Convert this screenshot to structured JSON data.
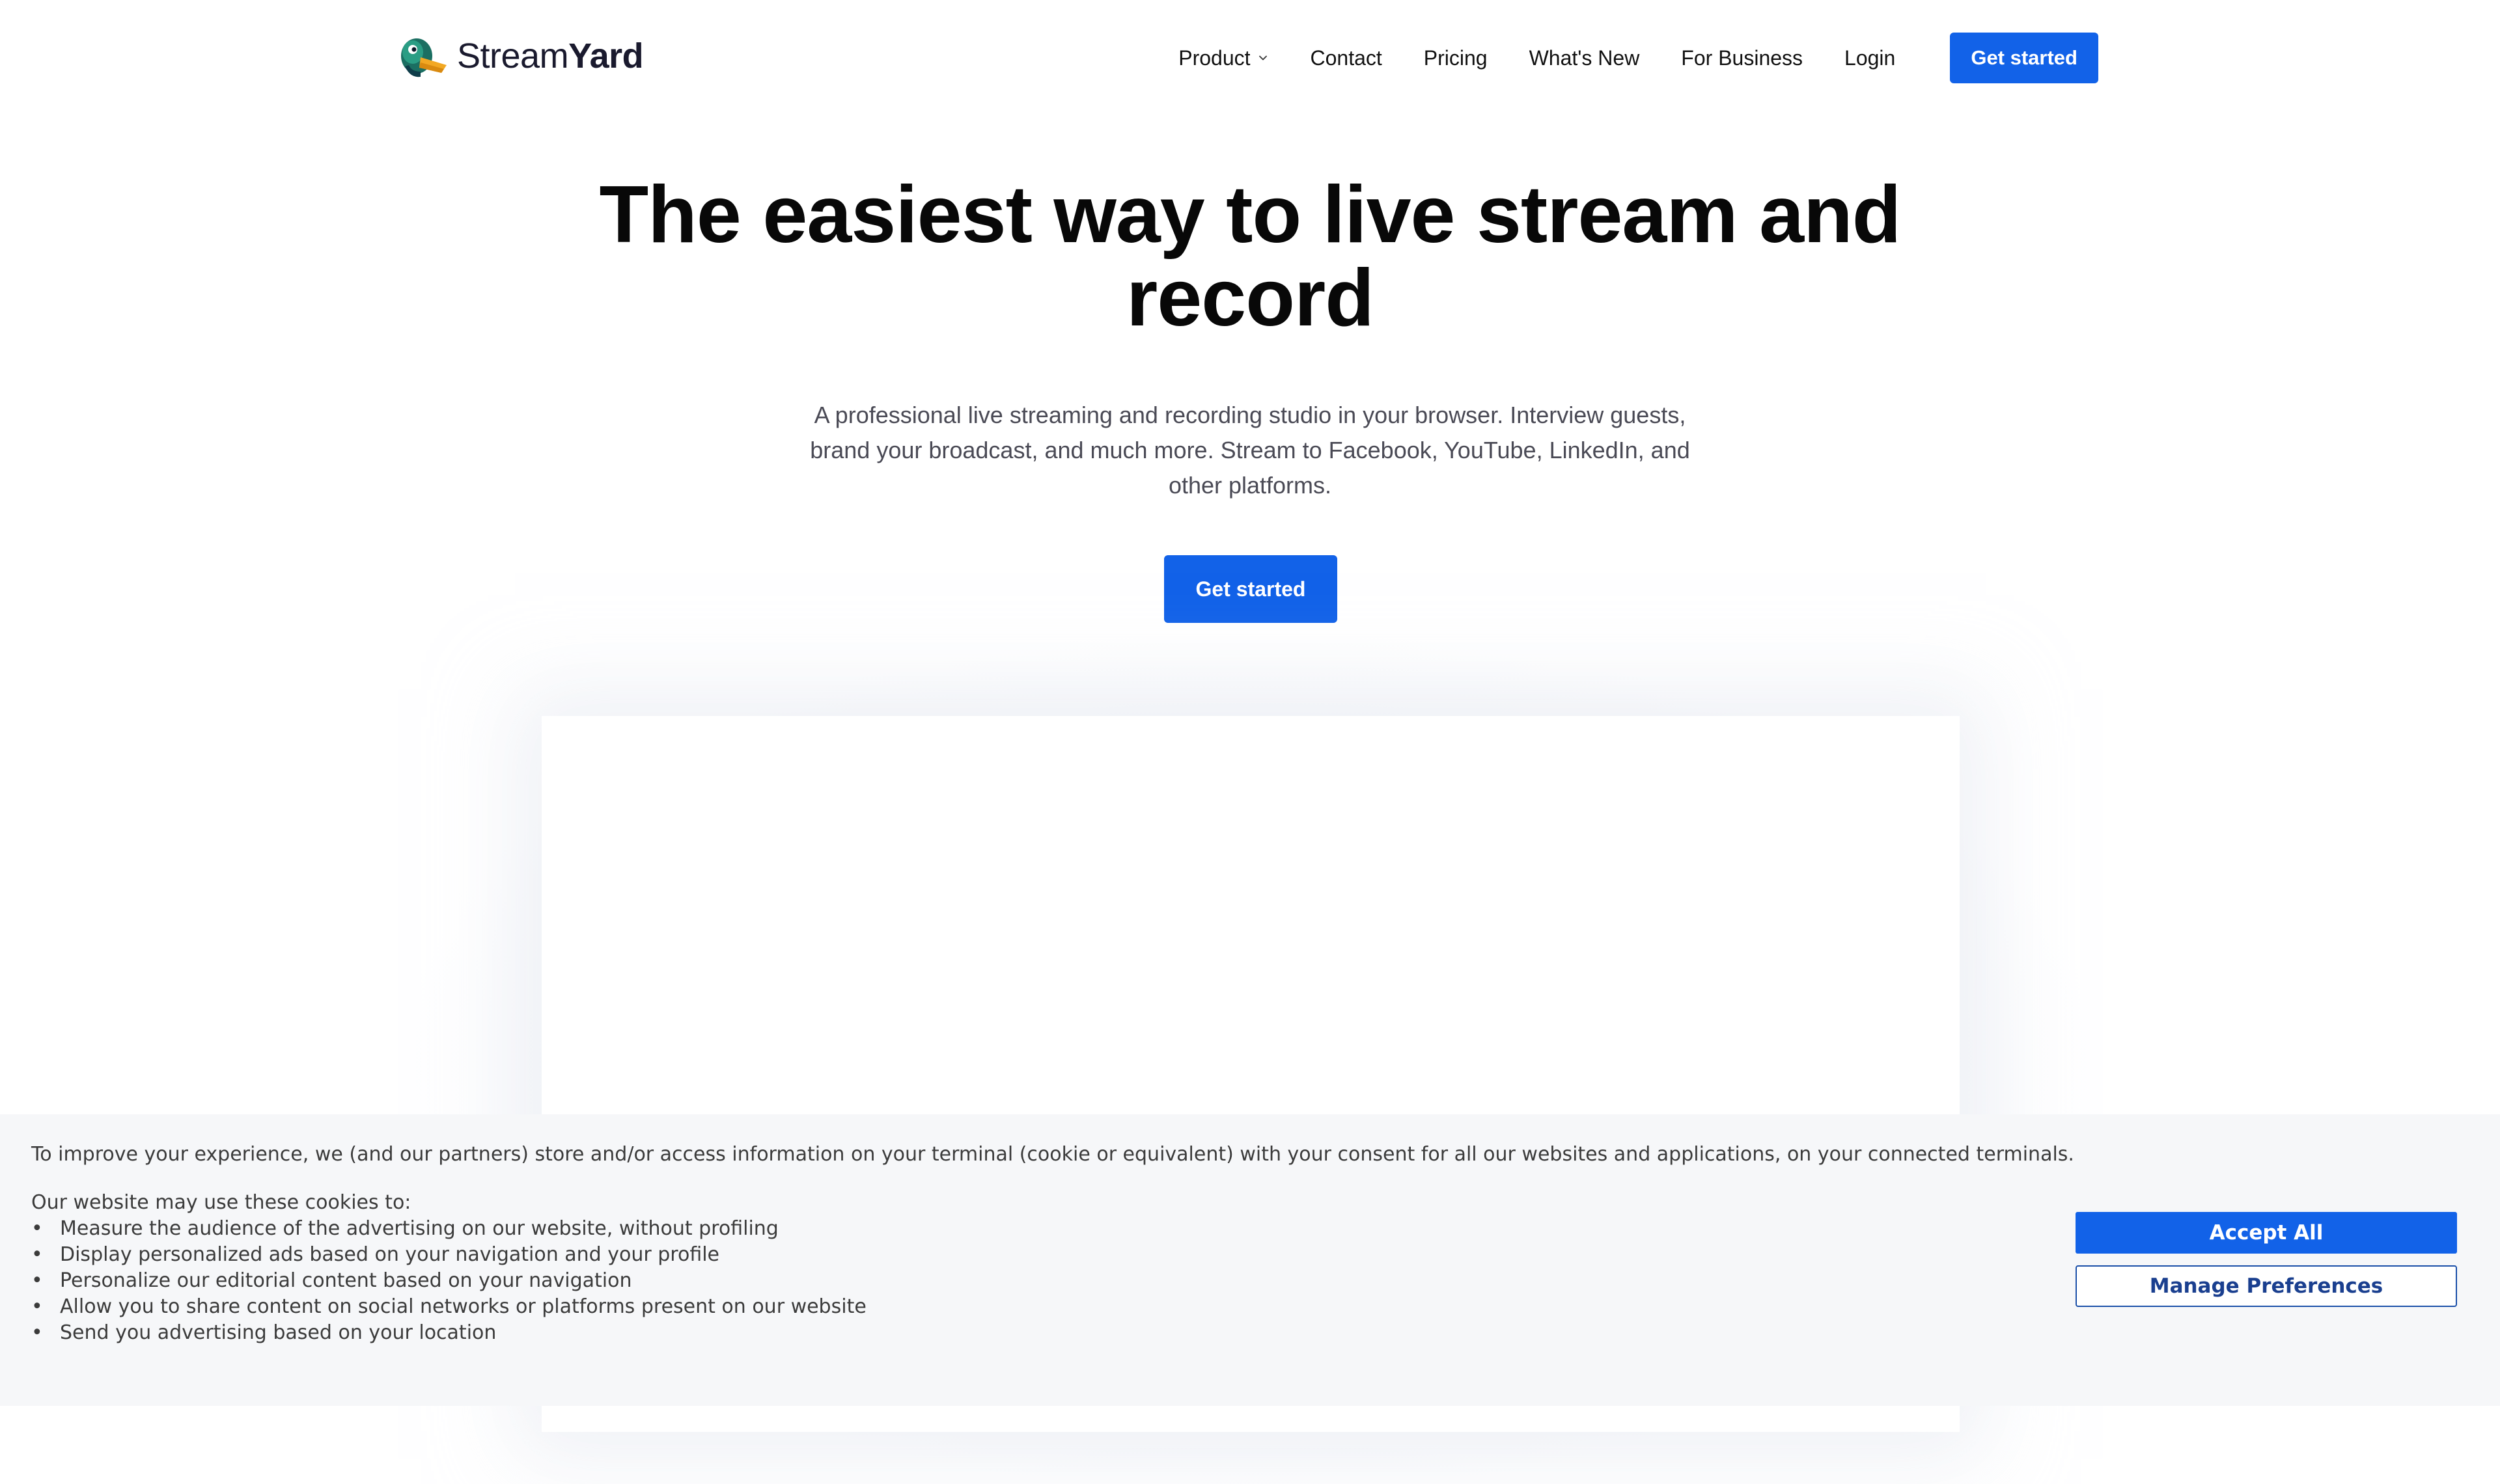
{
  "brand": {
    "name_light": "Stream",
    "name_bold": "Yard",
    "accent_color": "#1262e8",
    "logo_icon": "duck-mascot-icon"
  },
  "nav": {
    "items": [
      {
        "label": "Product",
        "has_dropdown": true
      },
      {
        "label": "Contact"
      },
      {
        "label": "Pricing"
      },
      {
        "label": "What's New"
      },
      {
        "label": "For Business"
      },
      {
        "label": "Login"
      }
    ],
    "cta_label": "Get started"
  },
  "hero": {
    "title": "The easiest way to live stream and record",
    "subtitle": "A professional live streaming and recording studio in your browser. Interview guests, brand your broadcast, and much more. Stream to Facebook, YouTube, LinkedIn, and other platforms.",
    "cta_label": "Get started"
  },
  "cookie_banner": {
    "intro": "To improve your experience, we (and our partners) store and/or access information on your terminal (cookie or equivalent) with your consent for all our websites and applications, on your connected terminals.",
    "list_title": "Our website may use these cookies to:",
    "items": [
      "Measure the audience of the advertising on our website, without profiling",
      "Display personalized ads based on your navigation and your profile",
      "Personalize our editorial content based on your navigation",
      "Allow you to share content on social networks or platforms present on our website",
      "Send you advertising based on your location"
    ],
    "accept_label": "Accept All",
    "manage_label": "Manage Preferences"
  }
}
